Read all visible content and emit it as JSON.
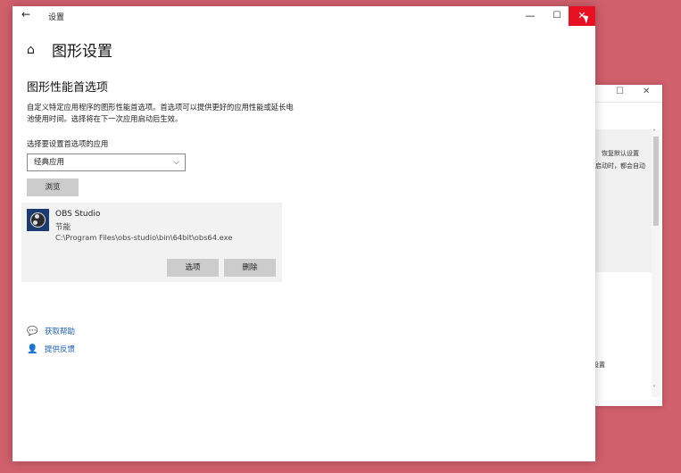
{
  "background_window": {
    "text_restore": "恢复默认设置",
    "text_startup": "启动时，都会自动",
    "text_settings": "设置"
  },
  "titlebar": {
    "title": "设置"
  },
  "page": {
    "title": "图形设置"
  },
  "section": {
    "title": "图形性能首选项",
    "description": "自定义特定应用程序的图形性能首选项。首选项可以提供更好的应用性能或延长电池使用时间。选择将在下一次应用启动后生效。",
    "select_label": "选择要设置首选项的应用",
    "dropdown_value": "经典应用",
    "browse_label": "浏览"
  },
  "app_entry": {
    "name": "OBS Studio",
    "preference": "节能",
    "path": "C:\\Program Files\\obs-studio\\bin\\64bit\\obs64.exe",
    "options_label": "选项",
    "delete_label": "删除"
  },
  "links": {
    "help": "获取帮助",
    "feedback": "提供反馈"
  },
  "colors": {
    "desktop": "#cf606c",
    "close_button": "#e81123",
    "link": "#1a5fb4",
    "button_gray": "#cccccc"
  },
  "icons": {
    "back": "back-arrow-icon",
    "home": "home-icon",
    "help": "help-chat-icon",
    "feedback": "feedback-person-icon"
  }
}
